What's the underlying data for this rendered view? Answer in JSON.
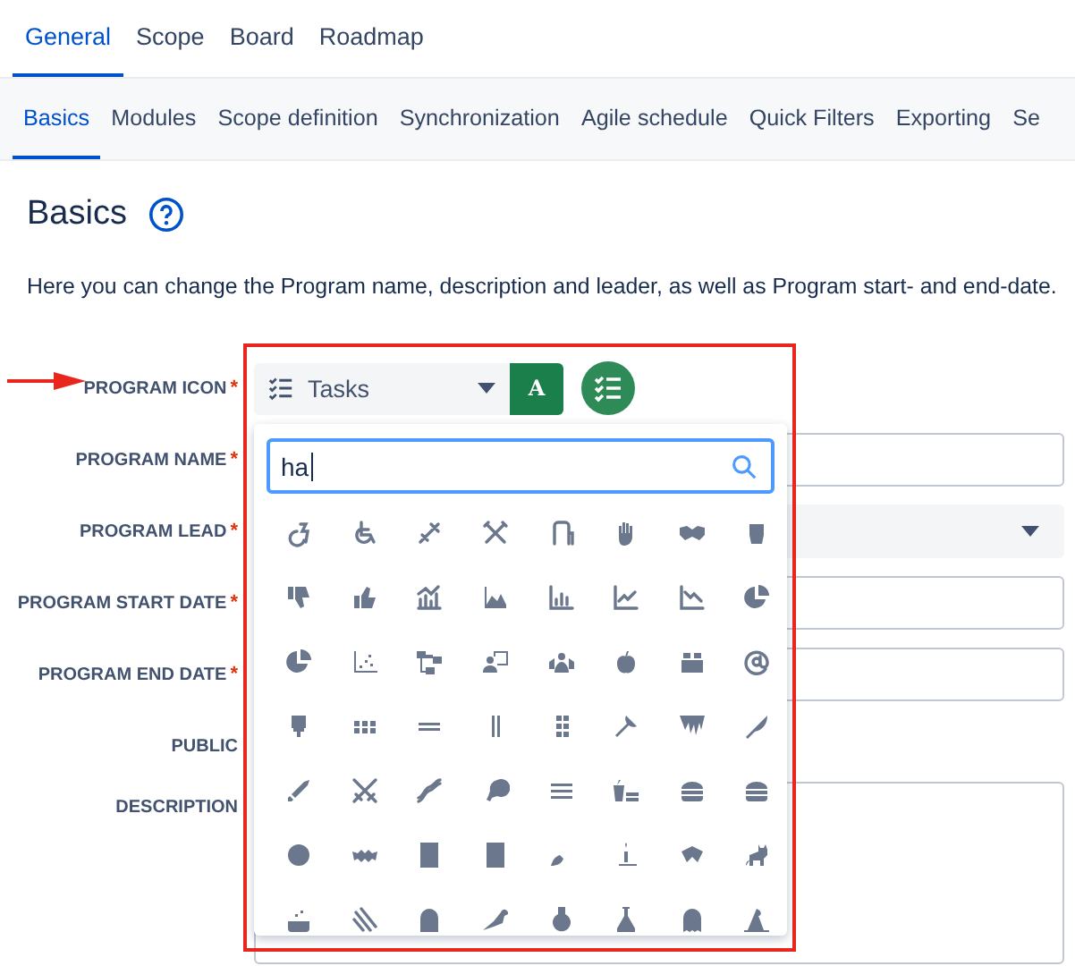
{
  "top_tabs": [
    {
      "label": "General",
      "selected": true
    },
    {
      "label": "Scope",
      "selected": false
    },
    {
      "label": "Board",
      "selected": false
    },
    {
      "label": "Roadmap",
      "selected": false
    }
  ],
  "sub_tabs": [
    {
      "label": "Basics",
      "selected": true
    },
    {
      "label": "Modules",
      "selected": false
    },
    {
      "label": "Scope definition",
      "selected": false
    },
    {
      "label": "Synchronization",
      "selected": false
    },
    {
      "label": "Agile schedule",
      "selected": false
    },
    {
      "label": "Quick Filters",
      "selected": false
    },
    {
      "label": "Exporting",
      "selected": false
    },
    {
      "label": "Se",
      "selected": false
    }
  ],
  "section": {
    "title": "Basics",
    "intro": "Here you can change the Program name, description and leader, as well as Program start- and end-date."
  },
  "form": {
    "fields": [
      {
        "label": "PROGRAM ICON",
        "required_mark": "*",
        "kind": "icon"
      },
      {
        "label": "PROGRAM NAME",
        "required_mark": "*",
        "kind": "text"
      },
      {
        "label": "PROGRAM LEAD",
        "required_mark": "*",
        "kind": "select"
      },
      {
        "label": "PROGRAM START DATE",
        "required_mark": "*",
        "kind": "date"
      },
      {
        "label": "PROGRAM END DATE",
        "required_mark": "*",
        "kind": "date"
      },
      {
        "label": "PUBLIC",
        "kind": "toggle"
      },
      {
        "label": "DESCRIPTION",
        "kind": "textarea"
      }
    ]
  },
  "icon_picker": {
    "selected_icon": "Tasks",
    "color_button": "A",
    "search": {
      "value": "ha"
    }
  }
}
